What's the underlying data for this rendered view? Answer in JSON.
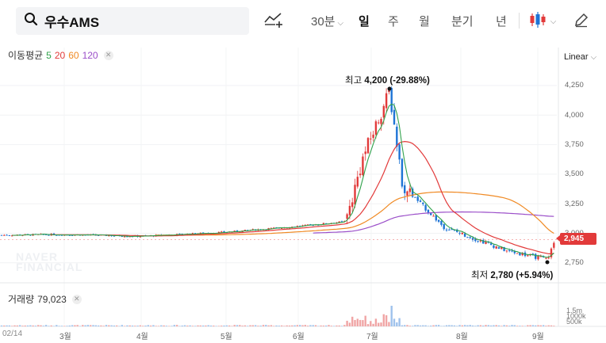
{
  "search": {
    "stock_name": "우수AMS"
  },
  "toolbar": {
    "periods": [
      "30분",
      "일",
      "주",
      "월",
      "분기",
      "년"
    ],
    "active_period": "일",
    "icons": [
      "search-icon",
      "compare-chart-icon",
      "candle-chart-icon",
      "pencil-icon"
    ]
  },
  "ma_legend": {
    "title": "이동평균",
    "periods": [
      {
        "label": "5",
        "color": "#31a24c"
      },
      {
        "label": "20",
        "color": "#e23a3a"
      },
      {
        "label": "60",
        "color": "#f08a24"
      },
      {
        "label": "120",
        "color": "#9b4fc9"
      }
    ]
  },
  "scale_mode": "Linear",
  "volume_legend": {
    "label": "거래량",
    "value": "79,023"
  },
  "watermark": [
    "NAVER",
    "FINANCIAL"
  ],
  "annotations": {
    "high_label": "최고",
    "high_value": "4,200 (-29.88%)",
    "low_label": "최저",
    "low_value": "2,780 (+5.94%)"
  },
  "current_price": "2,945",
  "colors": {
    "up": "#e23a3a",
    "down": "#1e74d6",
    "ma5": "#31a24c",
    "ma20": "#e23a3a",
    "ma60": "#f08a24",
    "ma120": "#9b4fc9"
  },
  "chart_data": {
    "type": "candlestick",
    "y_ticks": [
      "4,250",
      "4,000",
      "3,750",
      "3,500",
      "3,250",
      "3,000",
      "2,750"
    ],
    "ylim": [
      2680,
      4380
    ],
    "volume_ticks": [
      "1.5m",
      "1000k",
      "500k"
    ],
    "x_labels": [
      "02/14",
      "3월",
      "4월",
      "5월",
      "6월",
      "7월",
      "8월",
      "9월"
    ],
    "period_start": "2024-02-14",
    "price_anchors": [
      {
        "month": "2월",
        "close": 2985
      },
      {
        "month": "3월",
        "close": 2990
      },
      {
        "month": "4월",
        "close": 2975
      },
      {
        "month": "5월",
        "close": 3010
      },
      {
        "month": "6월",
        "close": 3060
      },
      {
        "month": "6월 말",
        "close": 3100
      },
      {
        "month": "7월 초",
        "close": 3650
      },
      {
        "month": "7월 최고",
        "close": 4200
      },
      {
        "month": "7월 말",
        "close": 3400
      },
      {
        "month": "8월",
        "close": 3050
      },
      {
        "month": "8월 말",
        "close": 2850
      },
      {
        "month": "9월 최저",
        "close": 2780
      },
      {
        "month": "9월",
        "close": 2945
      }
    ],
    "high": 4200,
    "low": 2780,
    "last_close": 2945,
    "last_volume": 79023
  }
}
